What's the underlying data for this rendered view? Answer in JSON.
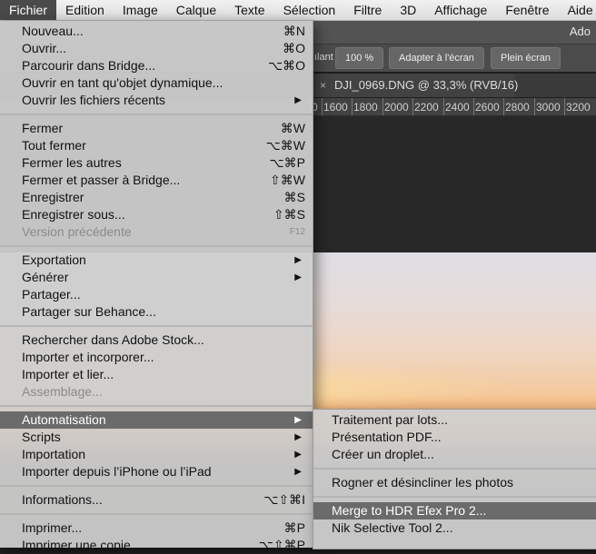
{
  "menubar": {
    "items": [
      {
        "label": "Fichier",
        "active": true
      },
      {
        "label": "Edition"
      },
      {
        "label": "Image"
      },
      {
        "label": "Calque"
      },
      {
        "label": "Texte"
      },
      {
        "label": "Sélection"
      },
      {
        "label": "Filtre"
      },
      {
        "label": "3D"
      },
      {
        "label": "Affichage"
      },
      {
        "label": "Fenêtre"
      },
      {
        "label": "Aide"
      }
    ]
  },
  "app": {
    "title_partial": "Ado",
    "options": {
      "partial_label": "ılant",
      "zoom": "100 %",
      "fit_screen": "Adapter à l'écran",
      "full_screen": "Plein écran"
    },
    "doc_tab": {
      "close": "×",
      "title": "DJI_0969.DNG @ 33,3% (RVB/16)"
    },
    "ruler_ticks": [
      "0",
      "1600",
      "1800",
      "2000",
      "2200",
      "2400",
      "2600",
      "2800",
      "3000",
      "3200"
    ]
  },
  "file_menu": {
    "groups": [
      [
        {
          "label": "Nouveau...",
          "shortcut": "⌘N"
        },
        {
          "label": "Ouvrir...",
          "shortcut": "⌘O"
        },
        {
          "label": "Parcourir dans Bridge...",
          "shortcut": "⌥⌘O"
        },
        {
          "label": "Ouvrir en tant qu'objet dynamique..."
        },
        {
          "label": "Ouvrir les fichiers récents",
          "submenu": true
        }
      ],
      [
        {
          "label": "Fermer",
          "shortcut": "⌘W"
        },
        {
          "label": "Tout fermer",
          "shortcut": "⌥⌘W"
        },
        {
          "label": "Fermer les autres",
          "shortcut": "⌥⌘P"
        },
        {
          "label": "Fermer et passer à Bridge...",
          "shortcut": "⇧⌘W"
        },
        {
          "label": "Enregistrer",
          "shortcut": "⌘S"
        },
        {
          "label": "Enregistrer sous...",
          "shortcut": "⇧⌘S"
        },
        {
          "label": "Version précédente",
          "shortcut": "F12",
          "disabled": true
        }
      ],
      [
        {
          "label": "Exportation",
          "submenu": true
        },
        {
          "label": "Générer",
          "submenu": true
        },
        {
          "label": "Partager..."
        },
        {
          "label": "Partager sur Behance..."
        }
      ],
      [
        {
          "label": "Rechercher dans Adobe Stock..."
        },
        {
          "label": "Importer et incorporer..."
        },
        {
          "label": "Importer et lier..."
        },
        {
          "label": "Assemblage...",
          "disabled": true
        }
      ],
      [
        {
          "label": "Automatisation",
          "submenu": true,
          "highlighted": true
        },
        {
          "label": "Scripts",
          "submenu": true
        },
        {
          "label": "Importation",
          "submenu": true
        },
        {
          "label": "Importer depuis l’iPhone ou l’iPad",
          "submenu": true
        }
      ],
      [
        {
          "label": "Informations...",
          "shortcut": "⌥⇧⌘I"
        }
      ],
      [
        {
          "label": "Imprimer...",
          "shortcut": "⌘P"
        },
        {
          "label": "Imprimer une copie",
          "shortcut": "⌥⇧⌘P"
        }
      ]
    ]
  },
  "automation_submenu": {
    "groups": [
      [
        {
          "label": "Traitement par lots..."
        },
        {
          "label": "Présentation PDF..."
        },
        {
          "label": "Créer un droplet..."
        }
      ],
      [
        {
          "label": "Rogner et désincliner les photos"
        }
      ],
      [
        {
          "label": "Merge to HDR Efex Pro 2...",
          "highlighted": true
        },
        {
          "label": "Nik Selective Tool 2..."
        }
      ]
    ]
  },
  "colors": {
    "menu_bg": "#cecece",
    "highlight": "#6b6b6b",
    "menubar_active": "#4a4a4a",
    "ps_panel": "#4b4b4b"
  },
  "icons": {
    "submenu_arrow": "▶"
  }
}
